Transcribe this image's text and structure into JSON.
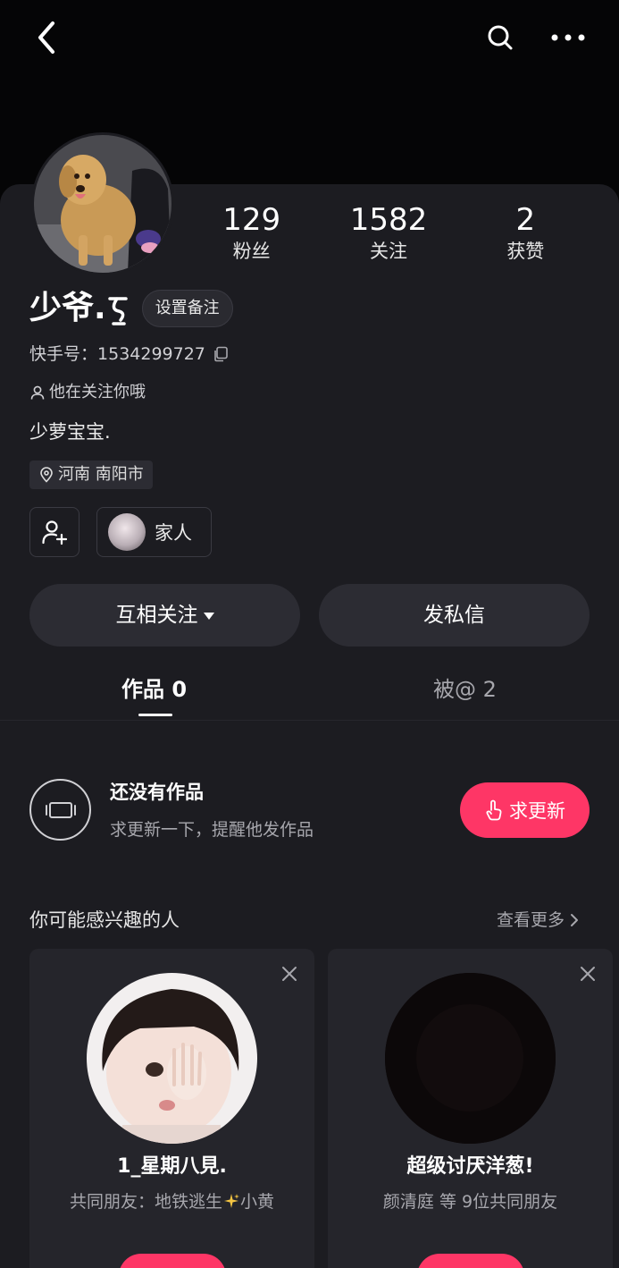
{
  "header": {
    "back_icon": "chevron-left-icon",
    "search_icon": "search-icon",
    "more_icon": "more-horizontal-icon"
  },
  "profile": {
    "avatar_alt": "golden retriever avatar",
    "stats": [
      {
        "value": "129",
        "label": "粉丝"
      },
      {
        "value": "1582",
        "label": "关注"
      },
      {
        "value": "2",
        "label": "获赞"
      }
    ],
    "name": "少爷.",
    "remark_button": "设置备注",
    "uid_label": "快手号：",
    "uid": "1534299727",
    "follow_hint": "他在关注你哦",
    "bio": "少萝宝宝.",
    "location": "河南 南阳市",
    "family_label": "家人"
  },
  "actions": {
    "mutual_follow": "互相关注",
    "message": "发私信"
  },
  "tabs": [
    {
      "label": "作品 0",
      "active": true
    },
    {
      "label": "被@ 2",
      "active": false
    }
  ],
  "empty_state": {
    "title": "还没有作品",
    "subtitle": "求更新一下，提醒他发作品",
    "request_button": "求更新"
  },
  "recommendations": {
    "title": "你可能感兴趣的人",
    "see_more": "查看更多",
    "cards": [
      {
        "name": "1_星期八見.",
        "mutual_prefix": "共同朋友：地铁逃生",
        "mutual_suffix": "小黄"
      },
      {
        "name": "超级讨厌洋葱!",
        "mutual_prefix": "颜清庭 等 9位共同朋友",
        "mutual_suffix": ""
      }
    ]
  },
  "colors": {
    "accent": "#fe3666",
    "background": "#1c1c21",
    "surface": "#2c2c33"
  }
}
